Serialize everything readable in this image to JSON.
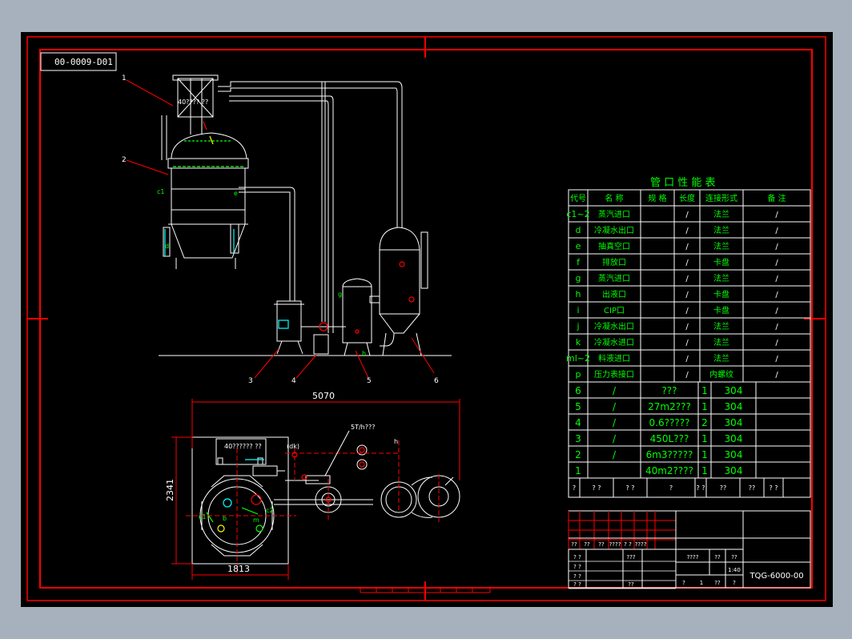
{
  "drawing_number": "00-0009-D01",
  "labels": {
    "callouts": [
      "1",
      "2",
      "3",
      "4",
      "5",
      "6"
    ],
    "condenser_tag": "40???? ??",
    "elevation_ports": {
      "c1": "c1",
      "e": "e",
      "d": "d",
      "g": "g",
      "h": "h"
    },
    "plan_tank_tag": "40?????? ??",
    "plan_ports": {
      "c1": "c1",
      "b": "b",
      "m": "m",
      "c2": "c2",
      "h": "h",
      "dk": "(dk)"
    },
    "plan_note": "5T/h???",
    "dim_total_width": "5070",
    "dim_base_width": "1813",
    "dim_base_depth": "2341"
  },
  "nozzle_table": {
    "title": "管 口 性 能 表",
    "headers": [
      "代号",
      "名 称",
      "规 格",
      "长度",
      "连接形式",
      "备 注"
    ],
    "rows": [
      [
        "c1~2",
        "蒸汽进口",
        "",
        "/",
        "法兰",
        "/"
      ],
      [
        "d",
        "冷凝水出口",
        "",
        "/",
        "法兰",
        "/"
      ],
      [
        "e",
        "抽真空口",
        "",
        "/",
        "法兰",
        "/"
      ],
      [
        "f",
        "排放口",
        "",
        "/",
        "卡盘",
        "/"
      ],
      [
        "g",
        "蒸汽进口",
        "",
        "/",
        "法兰",
        "/"
      ],
      [
        "h",
        "出液口",
        "",
        "/",
        "卡盘",
        "/"
      ],
      [
        "i",
        "CIP口",
        "",
        "/",
        "卡盘",
        "/"
      ],
      [
        "j",
        "冷凝水出口",
        "",
        "/",
        "法兰",
        "/"
      ],
      [
        "k",
        "冷凝水进口",
        "",
        "/",
        "法兰",
        "/"
      ],
      [
        "ml~2",
        "料液进口",
        "",
        "/",
        "法兰",
        "/"
      ],
      [
        "p",
        "压力表接口",
        "",
        "/",
        "内螺纹",
        "/"
      ]
    ]
  },
  "parts_list": {
    "rows": [
      [
        "6",
        "/",
        "???",
        "1",
        "304",
        ""
      ],
      [
        "5",
        "/",
        "27m2???",
        "1",
        "304",
        ""
      ],
      [
        "4",
        "/",
        "0.6?????",
        "2",
        "304",
        ""
      ],
      [
        "3",
        "/",
        "450L???",
        "1",
        "304",
        ""
      ],
      [
        "2",
        "/",
        "6m3?????",
        "1",
        "304",
        ""
      ],
      [
        "1",
        "",
        "40m2????",
        "1",
        "304",
        ""
      ]
    ],
    "header": [
      "?",
      "? ?",
      "? ?",
      "?",
      "? ?",
      "??",
      "??",
      "? ?"
    ]
  },
  "title_block": {
    "rev_row": [
      "??",
      "??",
      "??",
      "????",
      "? ?",
      "????"
    ],
    "sign_rows": [
      [
        "? ?",
        "???"
      ],
      [
        "? ?"
      ],
      [
        "? ?"
      ],
      [
        "? ?",
        "??"
      ]
    ],
    "weight_row": [
      "????",
      "??",
      "??"
    ],
    "scale": "1:40",
    "sheet_row": [
      "?",
      "1",
      "??",
      "?"
    ],
    "drawing_code": "TQG-6000-00"
  },
  "colors": {
    "background": "#000000",
    "frame": "#ff0000",
    "lines": "#ffffff",
    "text": "#00ff00",
    "accent_cyan": "#00ffff",
    "accent_yellow": "#ffff00",
    "window_bg": "#a7b0bd"
  }
}
